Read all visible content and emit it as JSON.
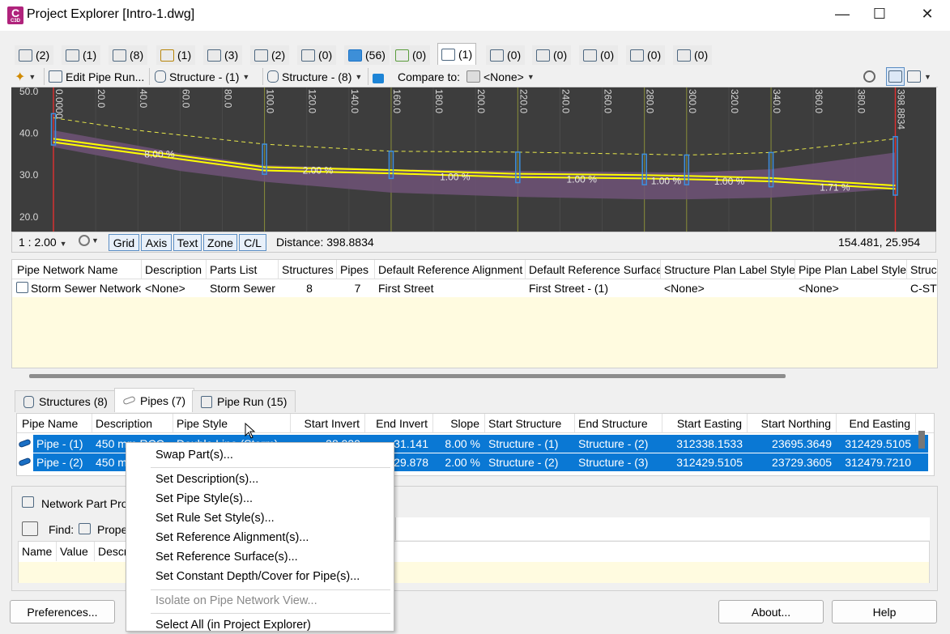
{
  "window": {
    "title": "Project Explorer [Intro-1.dwg]",
    "app_icon_letter": "C",
    "app_icon_sub": "C3D",
    "minimize": "—",
    "maximize": "☐",
    "close": "✕"
  },
  "top_tabs": [
    {
      "icon": "alignment-icon",
      "label": "(2)"
    },
    {
      "icon": "site-icon",
      "label": "(1)"
    },
    {
      "icon": "profile-icon",
      "label": "(8)"
    },
    {
      "icon": "corridor-icon",
      "label": "(1)"
    },
    {
      "icon": "assembly-icon",
      "label": "(3)"
    },
    {
      "icon": "surface-icon",
      "label": "(2)"
    },
    {
      "icon": "sample-line-icon",
      "label": "(0)"
    },
    {
      "icon": "point-icon",
      "label": "(56)"
    },
    {
      "icon": "parcel-icon",
      "label": "(0)"
    },
    {
      "icon": "pipe-network-icon",
      "label": "(1)"
    },
    {
      "icon": "pressure-network-icon",
      "label": "(0)"
    },
    {
      "icon": "catchment-icon",
      "label": "(0)"
    },
    {
      "icon": "feature-line-icon",
      "label": "(0)"
    },
    {
      "icon": "data-shortcut-icon",
      "label": "(0)"
    },
    {
      "icon": "survey-icon",
      "label": "(0)"
    }
  ],
  "toolbar": {
    "edit_pipe_run": "Edit Pipe Run...",
    "structure_a": "Structure - (1)",
    "structure_b": "Structure - (8)",
    "compare_label": "Compare to:",
    "compare_value": "<None>"
  },
  "profile_view": {
    "y_labels": [
      "50.0",
      "40.0",
      "30.0",
      "20.0"
    ],
    "x_labels": [
      "0.0000",
      "20.0",
      "40.0",
      "60.0",
      "80.0",
      "100.0",
      "120.0",
      "140.0",
      "160.0",
      "180.0",
      "200.0",
      "220.0",
      "240.0",
      "260.0",
      "280.0",
      "300.0",
      "320.0",
      "340.0",
      "360.0",
      "380.0",
      "398.8834"
    ],
    "slopes": [
      "8.00 %",
      "2.00 %",
      "1.00 %",
      "1.00 %",
      "1.00 %",
      "1.00 %",
      "1.71 %"
    ]
  },
  "profile_bar": {
    "scale": "1 : 2.00",
    "grid": "Grid",
    "axis": "Axis",
    "text": "Text",
    "zone": "Zone",
    "cl": "C/L",
    "distance": "Distance: 398.8834",
    "coords": "154.481, 25.954"
  },
  "network_grid": {
    "columns": [
      "Pipe Network Name",
      "Description",
      "Parts List",
      "Structures",
      "Pipes",
      "Default Reference Alignment",
      "Default Reference Surface",
      "Structure Plan Label Style",
      "Pipe Plan Label Style",
      "Struc"
    ],
    "row": [
      "Storm Sewer Network",
      "<None>",
      "Storm Sewer",
      "8",
      "7",
      "First Street",
      "First Street - (1)",
      "<None>",
      "<None>",
      "C-STR"
    ]
  },
  "sub_tabs": {
    "structures": "Structures (8)",
    "pipes": "Pipes (7)",
    "pipe_run": "Pipe Run (15)"
  },
  "pipe_grid": {
    "columns": [
      "Pipe Name",
      "Description",
      "Pipe Style",
      "Start Invert",
      "End Invert",
      "Slope",
      "Start Structure",
      "End Structure",
      "Start Easting",
      "Start Northing",
      "End Easting"
    ],
    "rows": [
      [
        "Pipe - (1)",
        "450 mm RCC",
        "Double Line (Storm)",
        "38.939",
        "31.141",
        "8.00 %",
        "Structure - (1)",
        "Structure - (2)",
        "312338.1533",
        "23695.3649",
        "312429.5105"
      ],
      [
        "Pipe - (2)",
        "450 mm",
        "",
        "",
        "29.878",
        "2.00 %",
        "Structure - (2)",
        "Structure - (3)",
        "312429.5105",
        "23729.3605",
        "312479.7210"
      ]
    ]
  },
  "props": {
    "title": "Network Part Pro",
    "find": "Find:",
    "prope": "Prope",
    "col_name": "Name",
    "col_value": "Value",
    "col_desc": "Descr"
  },
  "buttons": {
    "preferences": "Preferences...",
    "about": "About...",
    "help": "Help"
  },
  "context_menu": {
    "swap": "Swap Part(s)...",
    "set_desc": "Set Description(s)...",
    "set_pipe_style": "Set Pipe Style(s)...",
    "set_rule": "Set Rule Set Style(s)...",
    "set_align": "Set Reference Alignment(s)...",
    "set_surface": "Set Reference Surface(s)...",
    "set_depth": "Set Constant Depth/Cover for Pipe(s)...",
    "isolate": "Isolate on Pipe Network View...",
    "select_all": "Select All (in Project Explorer)"
  },
  "colors": {
    "selection": "#0a78d4",
    "profile_bg": "#3d3d3d",
    "pipe_yellow": "#ffff00",
    "band_purple": "#6e5277",
    "accent_magenta": "#b0237c"
  }
}
